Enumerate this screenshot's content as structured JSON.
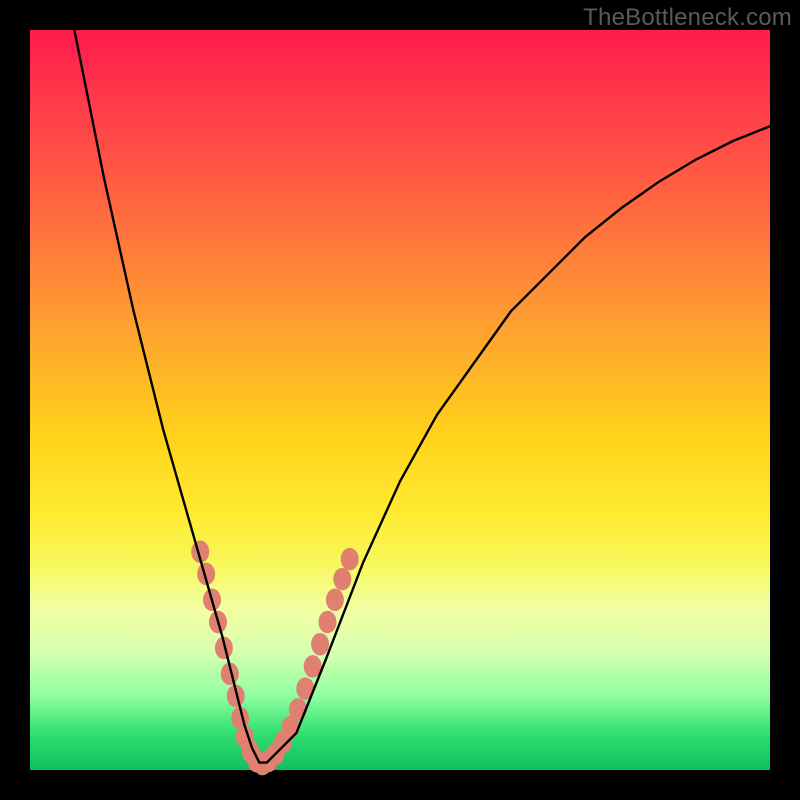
{
  "watermark": "TheBottleneck.com",
  "chart_data": {
    "type": "line",
    "title": "",
    "xlabel": "",
    "ylabel": "",
    "xlim": [
      0,
      100
    ],
    "ylim": [
      0,
      100
    ],
    "grid": false,
    "legend": false,
    "series": [
      {
        "name": "bottleneck-curve",
        "color": "#000000",
        "x": [
          6,
          8,
          10,
          12,
          14,
          16,
          18,
          20,
          22,
          24,
          26,
          28,
          29,
          30,
          31,
          32,
          36,
          40,
          45,
          50,
          55,
          60,
          65,
          70,
          75,
          80,
          85,
          90,
          95,
          100
        ],
        "y": [
          100,
          90,
          80,
          71,
          62,
          54,
          46,
          39,
          32,
          25,
          18,
          10,
          6,
          3,
          1,
          1,
          5,
          15,
          28,
          39,
          48,
          55,
          62,
          67,
          72,
          76,
          79.5,
          82.5,
          85,
          87
        ]
      }
    ],
    "markers": {
      "name": "highlight-dots",
      "color": "#e08070",
      "radius": 9,
      "points": [
        {
          "x": 23.0,
          "y": 29.5
        },
        {
          "x": 23.8,
          "y": 26.5
        },
        {
          "x": 24.6,
          "y": 23.0
        },
        {
          "x": 25.4,
          "y": 20.0
        },
        {
          "x": 26.2,
          "y": 16.5
        },
        {
          "x": 27.0,
          "y": 13.0
        },
        {
          "x": 27.8,
          "y": 10.0
        },
        {
          "x": 28.4,
          "y": 7.0
        },
        {
          "x": 29.0,
          "y": 4.5
        },
        {
          "x": 29.8,
          "y": 2.5
        },
        {
          "x": 30.6,
          "y": 1.2
        },
        {
          "x": 31.4,
          "y": 0.8
        },
        {
          "x": 32.2,
          "y": 1.2
        },
        {
          "x": 33.2,
          "y": 2.2
        },
        {
          "x": 34.2,
          "y": 3.8
        },
        {
          "x": 35.2,
          "y": 5.8
        },
        {
          "x": 36.2,
          "y": 8.2
        },
        {
          "x": 37.2,
          "y": 11.0
        },
        {
          "x": 38.2,
          "y": 14.0
        },
        {
          "x": 39.2,
          "y": 17.0
        },
        {
          "x": 40.2,
          "y": 20.0
        },
        {
          "x": 41.2,
          "y": 23.0
        },
        {
          "x": 42.2,
          "y": 25.8
        },
        {
          "x": 43.2,
          "y": 28.5
        }
      ]
    }
  }
}
